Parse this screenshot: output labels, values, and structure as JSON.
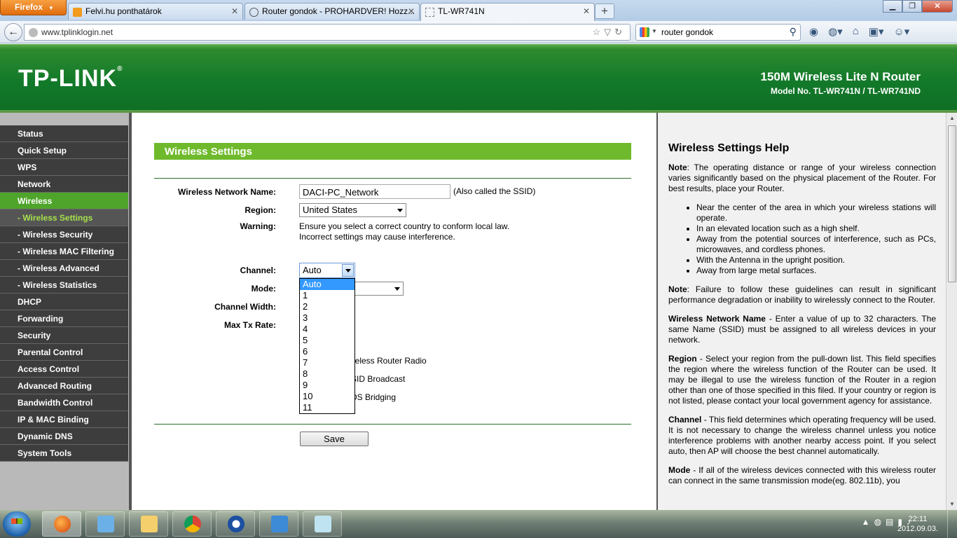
{
  "browser": {
    "menu_button": "Firefox",
    "tabs": [
      {
        "title": "Felvi.hu ponthatárok",
        "active": false
      },
      {
        "title": "Router gondok - PROHARDVER! Hozz...",
        "active": false
      },
      {
        "title": "TL-WR741N",
        "active": true
      }
    ],
    "url": "www.tplinklogin.net",
    "search_query": "router gondok"
  },
  "header": {
    "logo": "TP-LINK",
    "product_name": "150M Wireless Lite N Router",
    "model": "Model No. TL-WR741N / TL-WR741ND"
  },
  "menu": {
    "items": [
      {
        "label": "Status"
      },
      {
        "label": "Quick Setup"
      },
      {
        "label": "WPS"
      },
      {
        "label": "Network"
      },
      {
        "label": "Wireless"
      },
      {
        "label": "- Wireless Settings"
      },
      {
        "label": "- Wireless Security"
      },
      {
        "label": "- Wireless MAC Filtering"
      },
      {
        "label": "- Wireless Advanced"
      },
      {
        "label": "- Wireless Statistics"
      },
      {
        "label": "DHCP"
      },
      {
        "label": "Forwarding"
      },
      {
        "label": "Security"
      },
      {
        "label": "Parental Control"
      },
      {
        "label": "Access Control"
      },
      {
        "label": "Advanced Routing"
      },
      {
        "label": "Bandwidth Control"
      },
      {
        "label": "IP & MAC Binding"
      },
      {
        "label": "Dynamic DNS"
      },
      {
        "label": "System Tools"
      }
    ]
  },
  "form": {
    "title": "Wireless Settings",
    "ssid_label": "Wireless Network Name:",
    "ssid_value": "DACI-PC_Network",
    "ssid_note": "(Also called the SSID)",
    "region_label": "Region:",
    "region_value": "United States",
    "warning_label": "Warning:",
    "warning_line1": "Ensure you select a correct country to conform local law.",
    "warning_line2": "Incorrect settings may cause interference.",
    "channel_label": "Channel:",
    "channel_value": "Auto",
    "channel_options": [
      "Auto",
      "1",
      "2",
      "3",
      "4",
      "5",
      "6",
      "7",
      "8",
      "9",
      "10",
      "11"
    ],
    "mode_label": "Mode:",
    "width_label": "Channel Width:",
    "rate_label": "Max Tx Rate:",
    "radio_text": "ireless Router Radio",
    "ssid_broadcast_text": "SID Broadcast",
    "wds_text": "DS Bridging",
    "save_label": "Save"
  },
  "help": {
    "title": "Wireless Settings Help",
    "note1_label": "Note",
    "note1_text": ": The operating distance or range of your wireless connection varies significantly based on the physical placement of the Router. For best results, place your Router.",
    "bullets": [
      "Near the center of the area in which your wireless stations will operate.",
      "In an elevated location such as a high shelf.",
      "Away from the potential sources of interference, such as PCs, microwaves, and cordless phones.",
      "With the Antenna in the upright position.",
      "Away from large metal surfaces."
    ],
    "note2_label": "Note",
    "note2_text": ": Failure to follow these guidelines can result in significant performance degradation or inability to wirelessly connect to the Router.",
    "name_label": "Wireless Network Name",
    "name_text": " - Enter a value of up to 32 characters. The same Name (SSID) must be assigned to all wireless devices in your network.",
    "region_label": "Region",
    "region_text": " - Select your region from the pull-down list. This field specifies the region where the wireless function of the Router can be used. It may be illegal to use the wireless function of the Router in a region other than one of those specified in this filed. If your country or region is not listed, please contact your local government agency for assistance.",
    "channel_label": "Channel",
    "channel_text": " - This field determines which operating frequency will be used. It is not necessary to change the wireless channel unless you notice interference problems with another nearby access point. If you select auto, then AP will choose the best channel automatically.",
    "mode_label": "Mode",
    "mode_text": " - If all of the wireless devices connected with this wireless router can connect in the same transmission mode(eg. 802.11b), you"
  },
  "taskbar": {
    "time": "22:11",
    "date": "2012.09.03."
  },
  "colors": {
    "header_green": "#137a2a",
    "menu_active": "#4fa52b",
    "section_bar": "#6fba2c",
    "submenu_active_text": "#a6e04d"
  }
}
